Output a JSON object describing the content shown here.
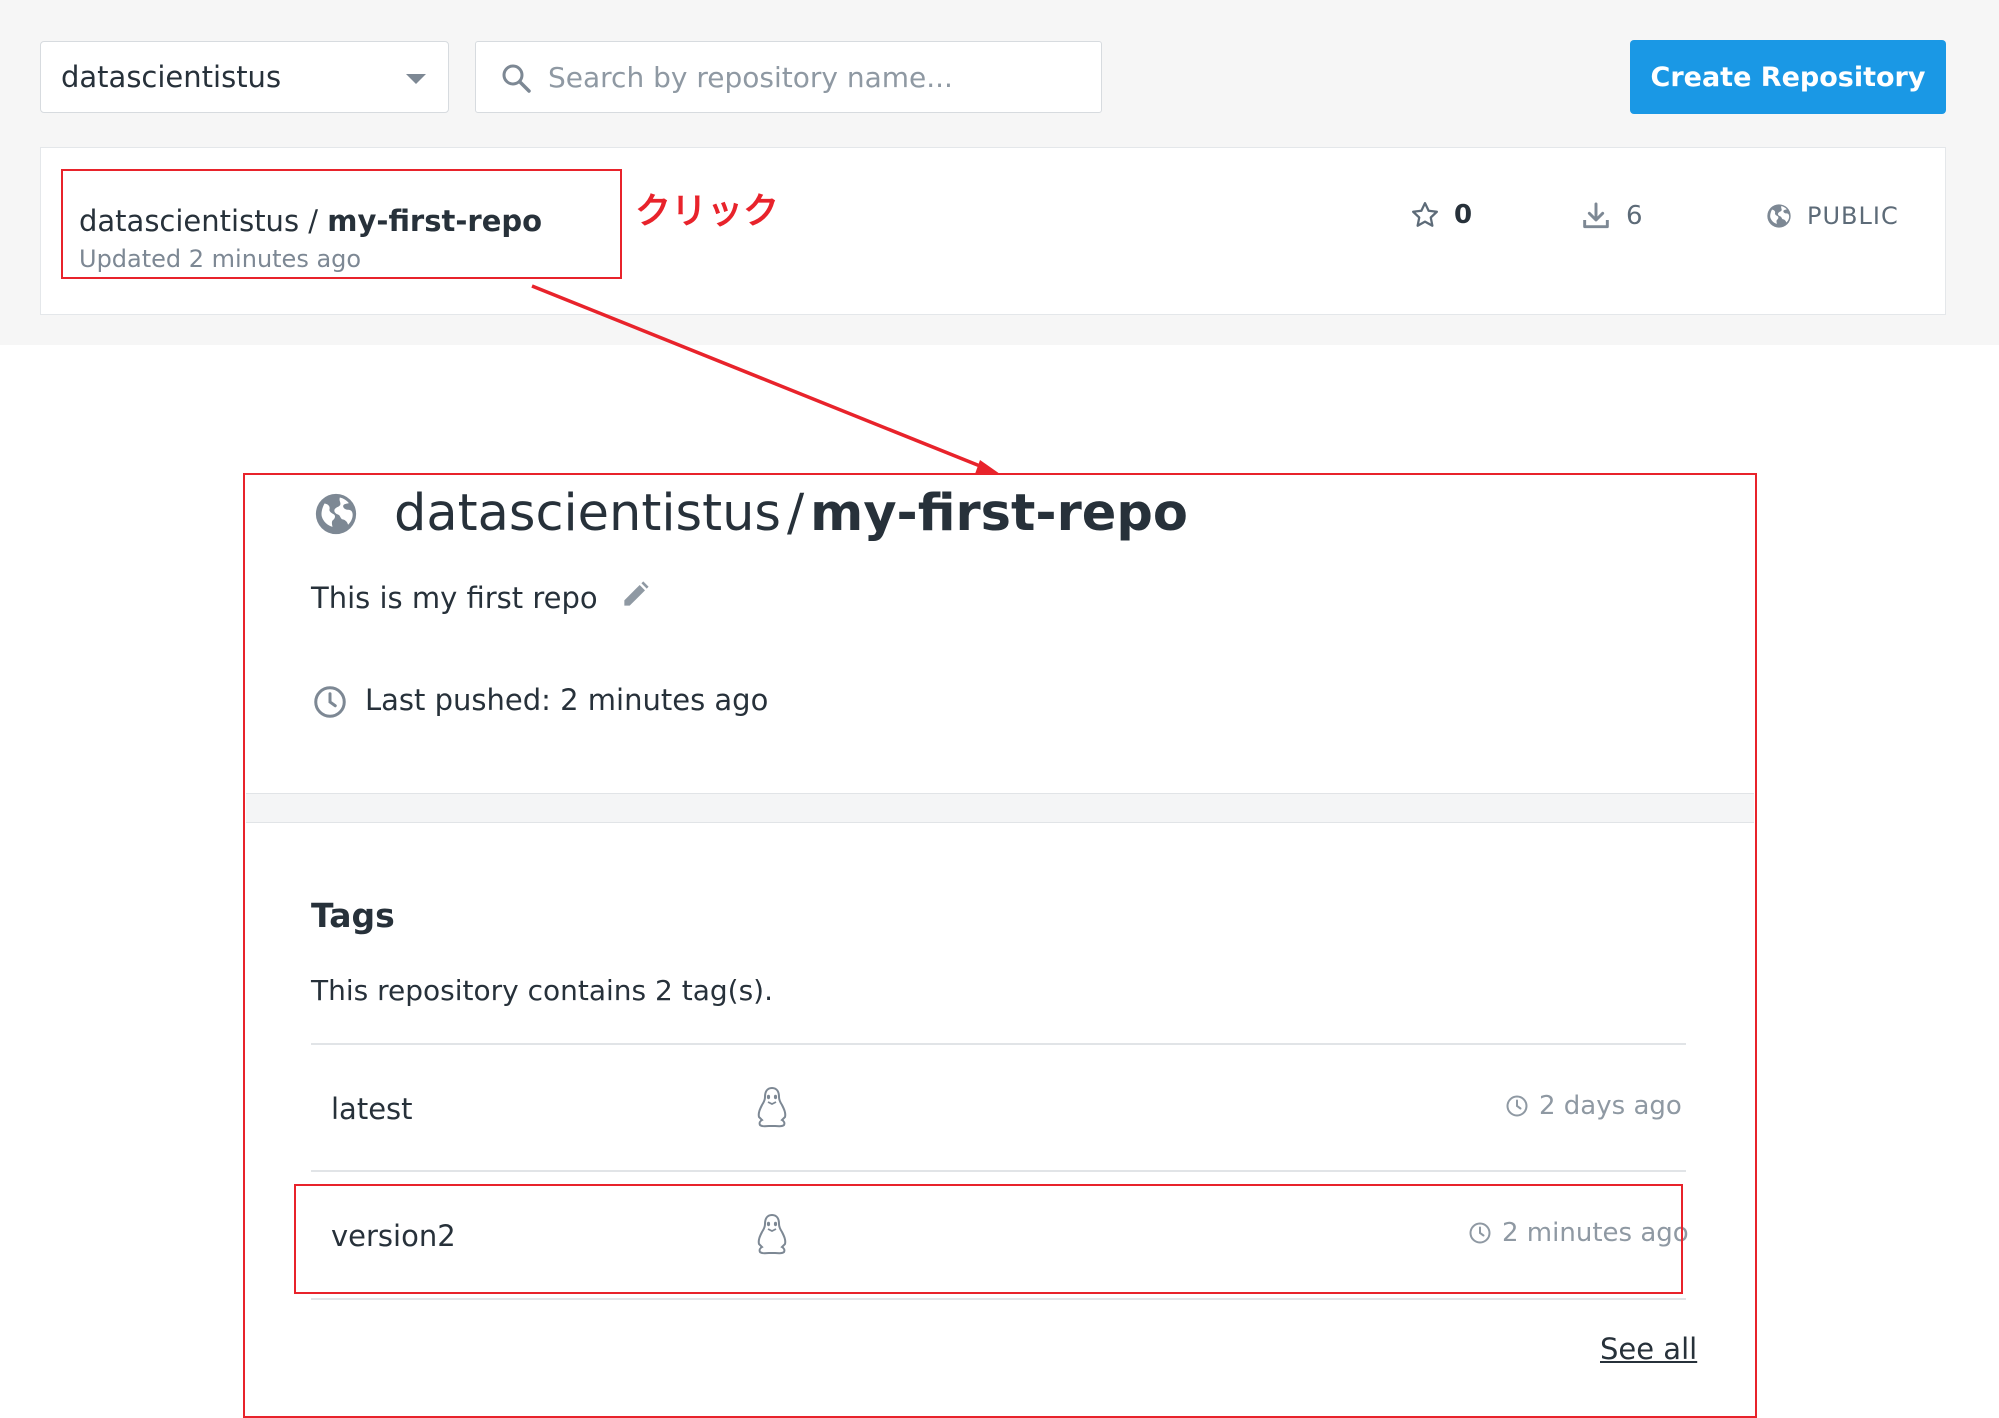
{
  "toolbar": {
    "namespace": "datascientistus",
    "search_placeholder": "Search by repository name...",
    "create_label": "Create Repository",
    "accent": "#1a98e5"
  },
  "repo_list": {
    "item": {
      "namespace": "datascientistus",
      "slash": " / ",
      "name": "my-first-repo",
      "updated": "Updated 2 minutes ago",
      "stars": "0",
      "pulls": "6",
      "visibility": "PUBLIC"
    }
  },
  "annotation": {
    "click_label": "クリック",
    "color": "#e8232b"
  },
  "detail": {
    "namespace": "datascientistus",
    "slash": "/",
    "name": "my-first-repo",
    "description": "This is my first repo",
    "last_pushed": "Last pushed: 2 minutes ago",
    "tags_heading": "Tags",
    "tags_count": "This repository contains 2 tag(s).",
    "tags": [
      {
        "name": "latest",
        "os_icon": "linux-icon",
        "time": "2 days ago"
      },
      {
        "name": "version2",
        "os_icon": "linux-icon",
        "time": "2 minutes ago"
      }
    ],
    "see_all": "See all"
  }
}
